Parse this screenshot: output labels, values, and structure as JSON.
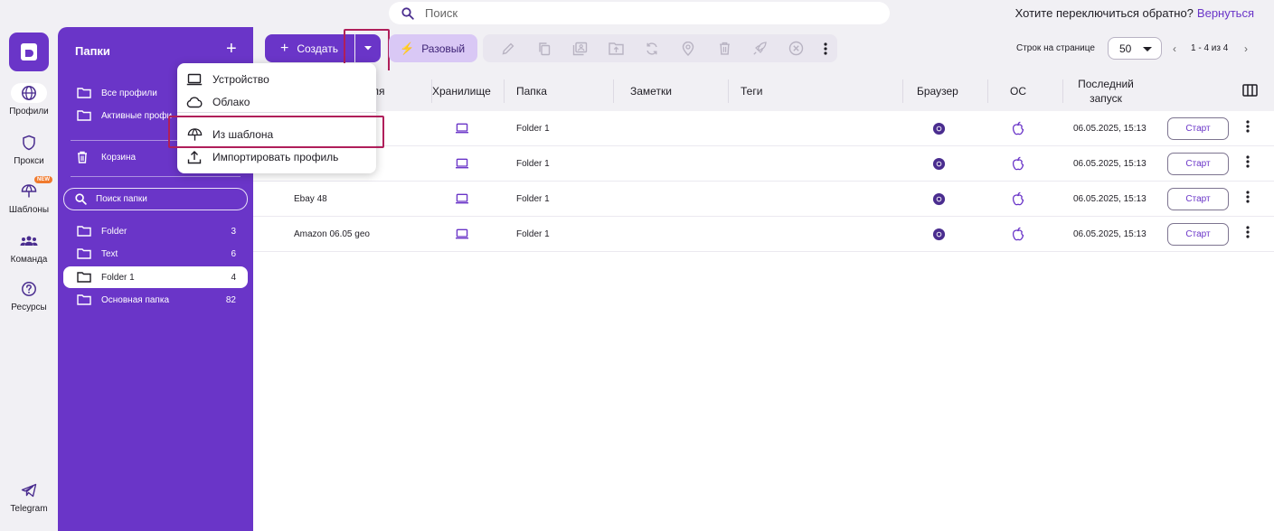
{
  "search": {
    "placeholder": "Поиск"
  },
  "switch_back": {
    "question": "Хотите переключиться обратно?",
    "link": "Вернуться"
  },
  "rail": {
    "items": [
      {
        "label": "Профили",
        "icon": "globe-icon"
      },
      {
        "label": "Прокси",
        "icon": "shield-icon"
      },
      {
        "label": "Шаблоны",
        "icon": "umbrella-icon",
        "badge": "NEW"
      },
      {
        "label": "Команда",
        "icon": "team-icon"
      },
      {
        "label": "Ресурсы",
        "icon": "help-icon"
      }
    ],
    "telegram": "Telegram"
  },
  "folders": {
    "title": "Папки",
    "all_profiles": "Все профили",
    "active_profiles": "Активные профи",
    "trash": "Корзина",
    "search_placeholder": "Поиск папки",
    "list": [
      {
        "name": "Folder",
        "count": "3"
      },
      {
        "name": "Text",
        "count": "6"
      },
      {
        "name": "Folder 1",
        "count": "4"
      },
      {
        "name": "Основная папка",
        "count": "82"
      }
    ]
  },
  "toolbar": {
    "create": "Создать",
    "one_time": "Разовый",
    "rows_per_page_label": "Строк на странице",
    "rows_per_page": "50",
    "pagination": "1 - 4 из 4"
  },
  "menu": {
    "items": [
      {
        "label": "Устройство",
        "icon": "laptop-icon"
      },
      {
        "label": "Облако",
        "icon": "cloud-icon"
      },
      {
        "label": "Из шаблона",
        "icon": "umbrella-icon"
      },
      {
        "label": "Импортировать профиль",
        "icon": "upload-icon"
      }
    ]
  },
  "table": {
    "headers": {
      "name": "ля",
      "storage": "Хранилище",
      "folder": "Папка",
      "notes": "Заметки",
      "tags": "Теги",
      "browser": "Браузер",
      "os": "ОС",
      "last_launch_1": "Последний",
      "last_launch_2": "запуск"
    },
    "rows": [
      {
        "name": "",
        "folder": "Folder 1",
        "last_launch": "06.05.2025, 15:13",
        "action": "Старт"
      },
      {
        "name": "",
        "folder": "Folder 1",
        "last_launch": "06.05.2025, 15:13",
        "action": "Старт"
      },
      {
        "name": "Ebay 48",
        "folder": "Folder 1",
        "last_launch": "06.05.2025, 15:13",
        "action": "Старт"
      },
      {
        "name": "Amazon 06.05 geo",
        "folder": "Folder 1",
        "last_launch": "06.05.2025, 15:13",
        "action": "Старт"
      }
    ]
  },
  "colors": {
    "accent": "#6a35c8",
    "highlight": "#b01f5a",
    "badge": "#f07a2e"
  }
}
